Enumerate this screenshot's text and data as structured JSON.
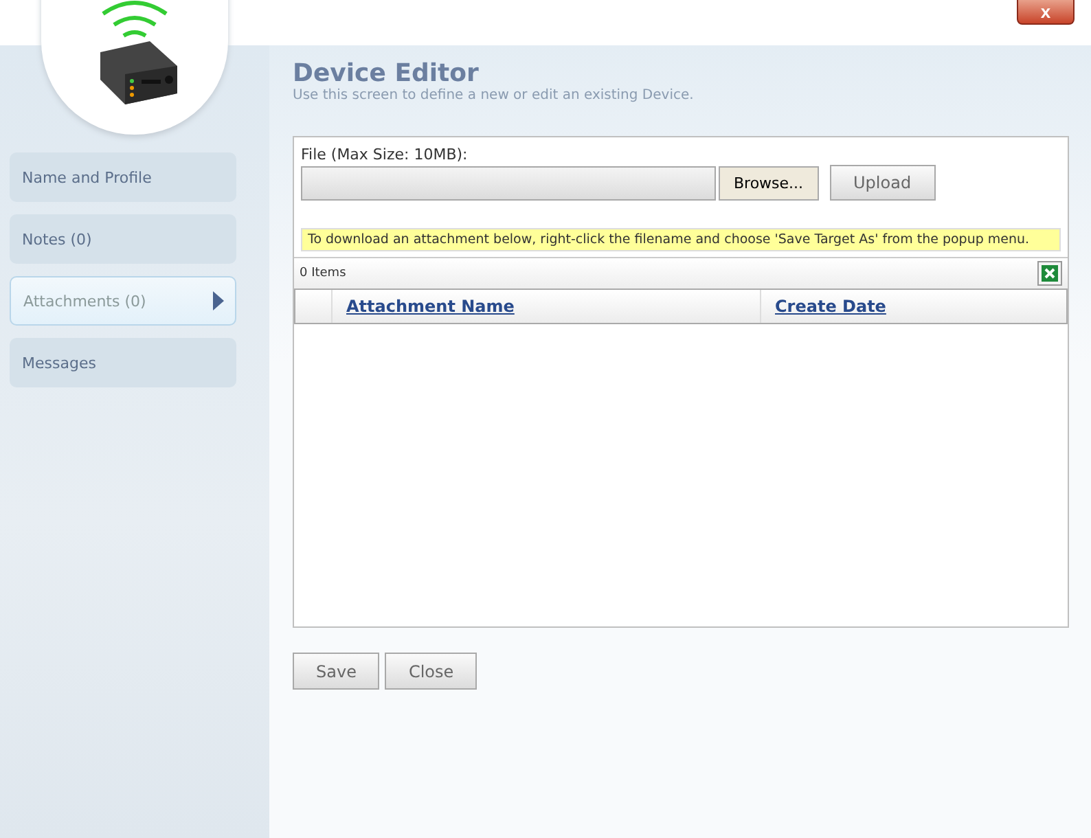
{
  "window": {
    "close_label": "x"
  },
  "sidebar": {
    "items": [
      {
        "label": "Name and Profile",
        "selected": false
      },
      {
        "label": "Notes (0)",
        "selected": false
      },
      {
        "label": "Attachments (0)",
        "selected": true
      },
      {
        "label": "Messages",
        "selected": false
      }
    ]
  },
  "header": {
    "title": "Device Editor",
    "subtitle": "Use this screen to define a new or edit an existing Device."
  },
  "upload": {
    "label": "File (Max Size: 10MB):",
    "browse": "Browse...",
    "upload": "Upload",
    "notice": "To download an attachment below, right-click the filename and choose 'Save Target As' from the popup menu."
  },
  "grid": {
    "count": "0 Items",
    "columns": [
      "Attachment Name",
      "Create Date"
    ]
  },
  "buttons": [
    "Save",
    "Close"
  ]
}
